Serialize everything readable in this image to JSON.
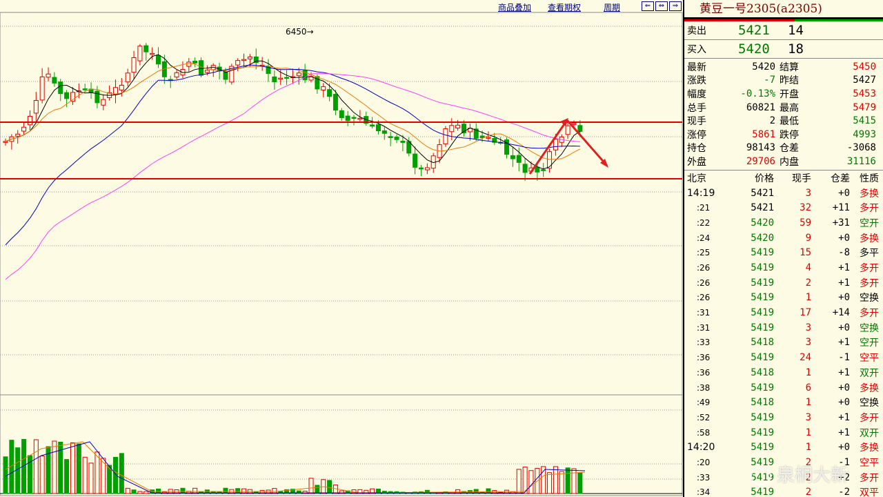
{
  "toolbar": {
    "overlay_label": "商品叠加",
    "options_label": "查看期权",
    "period_label": "周期",
    "nav_icons": [
      "⇐",
      "⇔",
      "⇒"
    ]
  },
  "chart": {
    "high_annotation": "6450→"
  },
  "panel": {
    "title": "黄豆一号2305(a2305)",
    "ask": {
      "label": "卖出",
      "price": "5421",
      "vol": "14"
    },
    "bid": {
      "label": "买入",
      "price": "5420",
      "vol": "18"
    },
    "stats": [
      {
        "k": "最新",
        "v": "5420",
        "vc": "#000",
        "k2": "结算",
        "v2": "5450",
        "v2c": "#e00000"
      },
      {
        "k": "涨跌",
        "v": "-7",
        "vc": "#007700",
        "k2": "昨结",
        "v2": "5427",
        "v2c": "#000"
      },
      {
        "k": "幅度",
        "v": "-0.13%",
        "vc": "#007700",
        "k2": "开盘",
        "v2": "5453",
        "v2c": "#e00000"
      },
      {
        "k": "总手",
        "v": "60821",
        "vc": "#000",
        "k2": "最高",
        "v2": "5479",
        "v2c": "#e00000"
      },
      {
        "k": "现手",
        "v": "2",
        "vc": "#000",
        "k2": "最低",
        "v2": "5415",
        "v2c": "#007700"
      },
      {
        "k": "涨停",
        "v": "5861",
        "vc": "#e00000",
        "k2": "跌停",
        "v2": "4993",
        "v2c": "#007700"
      },
      {
        "k": "持仓",
        "v": "98143",
        "vc": "#000",
        "k2": "仓差",
        "v2": "-3068",
        "v2c": "#000"
      },
      {
        "k": "外盘",
        "v": "29706",
        "vc": "#e00000",
        "k2": "内盘",
        "v2": "31116",
        "v2c": "#007700"
      }
    ],
    "tick_header": {
      "time": "北京",
      "price": "价格",
      "vol": "现手",
      "oi": "仓差",
      "nature": "性质"
    },
    "ticks": [
      {
        "t": "14:19",
        "big": true,
        "p": "5421",
        "pc": "#000",
        "v": "3",
        "oi": "+0",
        "n": "多换",
        "nc": "#e00000"
      },
      {
        "t": ":21",
        "p": "5421",
        "pc": "#000",
        "v": "32",
        "oi": "+11",
        "n": "多开",
        "nc": "#e00000"
      },
      {
        "t": ":22",
        "p": "5420",
        "pc": "#007700",
        "v": "59",
        "oi": "+31",
        "n": "空开",
        "nc": "#007700"
      },
      {
        "t": ":24",
        "p": "5420",
        "pc": "#007700",
        "v": "9",
        "oi": "+0",
        "n": "多换",
        "nc": "#e00000"
      },
      {
        "t": ":25",
        "p": "5419",
        "pc": "#007700",
        "v": "15",
        "oi": "-8",
        "n": "多平",
        "nc": "#000"
      },
      {
        "t": ":26",
        "p": "5419",
        "pc": "#007700",
        "v": "4",
        "oi": "+1",
        "n": "多开",
        "nc": "#e00000"
      },
      {
        "t": ":26",
        "p": "5419",
        "pc": "#007700",
        "v": "2",
        "oi": "+1",
        "n": "多开",
        "nc": "#e00000"
      },
      {
        "t": ":26",
        "p": "5419",
        "pc": "#007700",
        "v": "1",
        "oi": "+0",
        "n": "空换",
        "nc": "#000"
      },
      {
        "t": ":31",
        "p": "5419",
        "pc": "#007700",
        "v": "17",
        "oi": "+14",
        "n": "多开",
        "nc": "#e00000"
      },
      {
        "t": ":31",
        "p": "5419",
        "pc": "#007700",
        "v": "3",
        "oi": "+0",
        "n": "空换",
        "nc": "#007700"
      },
      {
        "t": ":33",
        "p": "5418",
        "pc": "#007700",
        "v": "3",
        "oi": "+1",
        "n": "空开",
        "nc": "#007700"
      },
      {
        "t": ":36",
        "p": "5419",
        "pc": "#007700",
        "v": "24",
        "oi": "-1",
        "n": "空平",
        "nc": "#e00000"
      },
      {
        "t": ":36",
        "p": "5418",
        "pc": "#007700",
        "v": "1",
        "oi": "+1",
        "n": "双开",
        "nc": "#007700"
      },
      {
        "t": ":38",
        "p": "5419",
        "pc": "#007700",
        "v": "6",
        "oi": "+0",
        "n": "多换",
        "nc": "#e00000"
      },
      {
        "t": ":49",
        "p": "5418",
        "pc": "#007700",
        "v": "1",
        "oi": "+0",
        "n": "空换",
        "nc": "#000"
      },
      {
        "t": ":52",
        "p": "5419",
        "pc": "#007700",
        "v": "3",
        "oi": "+1",
        "n": "多开",
        "nc": "#e00000"
      },
      {
        "t": ":58",
        "p": "5419",
        "pc": "#007700",
        "v": "1",
        "oi": "+1",
        "n": "双开",
        "nc": "#007700"
      },
      {
        "t": "14:20",
        "big": true,
        "p": "5419",
        "pc": "#007700",
        "v": "1",
        "oi": "+0",
        "n": "多换",
        "nc": "#e00000"
      },
      {
        "t": ":20",
        "p": "5419",
        "pc": "#007700",
        "v": "2",
        "oi": "-1",
        "n": "空平",
        "nc": "#e00000"
      },
      {
        "t": ":33",
        "p": "5419",
        "pc": "#007700",
        "v": "2",
        "oi": "+2",
        "n": "多开",
        "nc": "#e00000"
      },
      {
        "t": ":34",
        "p": "5419",
        "pc": "#007700",
        "v": "2",
        "oi": "-2",
        "n": "双平",
        "nc": "#e00000"
      }
    ]
  },
  "watermark": "泉桐大新",
  "colors": {
    "up": "#e00000",
    "down": "#00a000",
    "bg": "#fdfbe3",
    "ma_blue": "#0000c8",
    "ma_orange": "#f07800",
    "ma_magenta": "#ff40ff",
    "ma_black": "#000000"
  }
}
